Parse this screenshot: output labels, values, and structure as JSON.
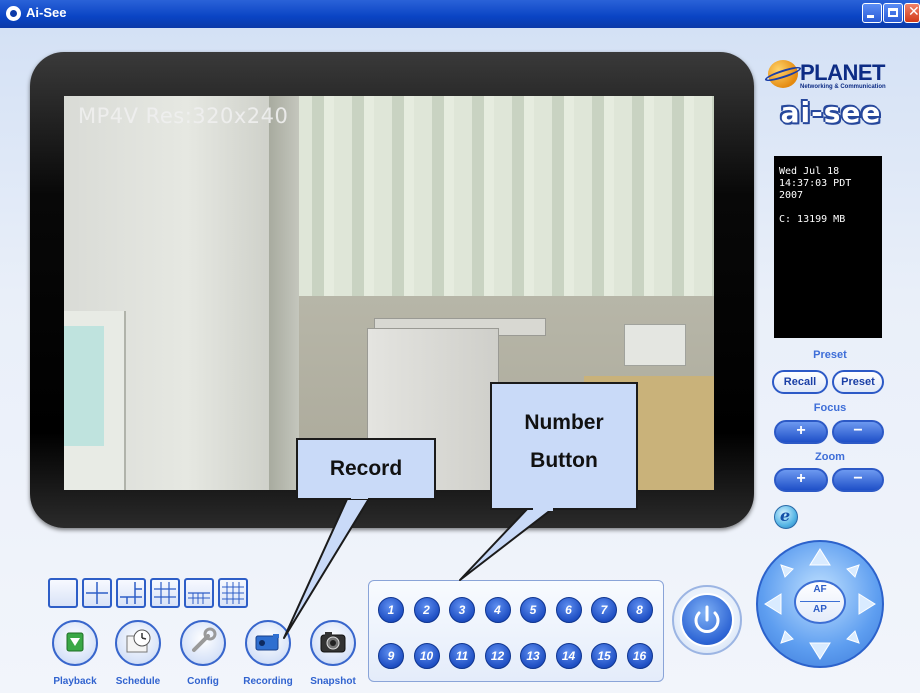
{
  "window": {
    "title": "Ai-See"
  },
  "video": {
    "overlay": "MP4V Res:320x240"
  },
  "brand": {
    "name": "PLANET",
    "tagline": "Networking & Communication",
    "product": "ai-see"
  },
  "info": {
    "text": "Wed Jul 18\n14:37:03 PDT\n2007\n\nC: 13199 MB"
  },
  "preset": {
    "label": "Preset",
    "recall": "Recall",
    "preset": "Preset"
  },
  "focus": {
    "label": "Focus",
    "plus": "+",
    "minus": "−"
  },
  "zoom": {
    "label": "Zoom",
    "plus": "+",
    "minus": "−"
  },
  "ie_icon": "e",
  "ptz": {
    "af": "AF",
    "ap": "AP"
  },
  "toolbar": [
    {
      "label": "Playback",
      "icon": "playback-icon"
    },
    {
      "label": "Schedule",
      "icon": "schedule-icon"
    },
    {
      "label": "Config",
      "icon": "wrench-icon"
    },
    {
      "label": "Recording",
      "icon": "camera-icon"
    },
    {
      "label": "Snapshot",
      "icon": "snapshot-icon"
    }
  ],
  "numbers": [
    "1",
    "2",
    "3",
    "4",
    "5",
    "6",
    "7",
    "8",
    "9",
    "10",
    "11",
    "12",
    "13",
    "14",
    "15",
    "16"
  ],
  "callouts": {
    "record": "Record",
    "number_line1": "Number",
    "number_line2": "Button"
  },
  "colors": {
    "accent": "#2e5ec7",
    "title_bar": "#0a44c4",
    "label_blue": "#3163cf"
  }
}
